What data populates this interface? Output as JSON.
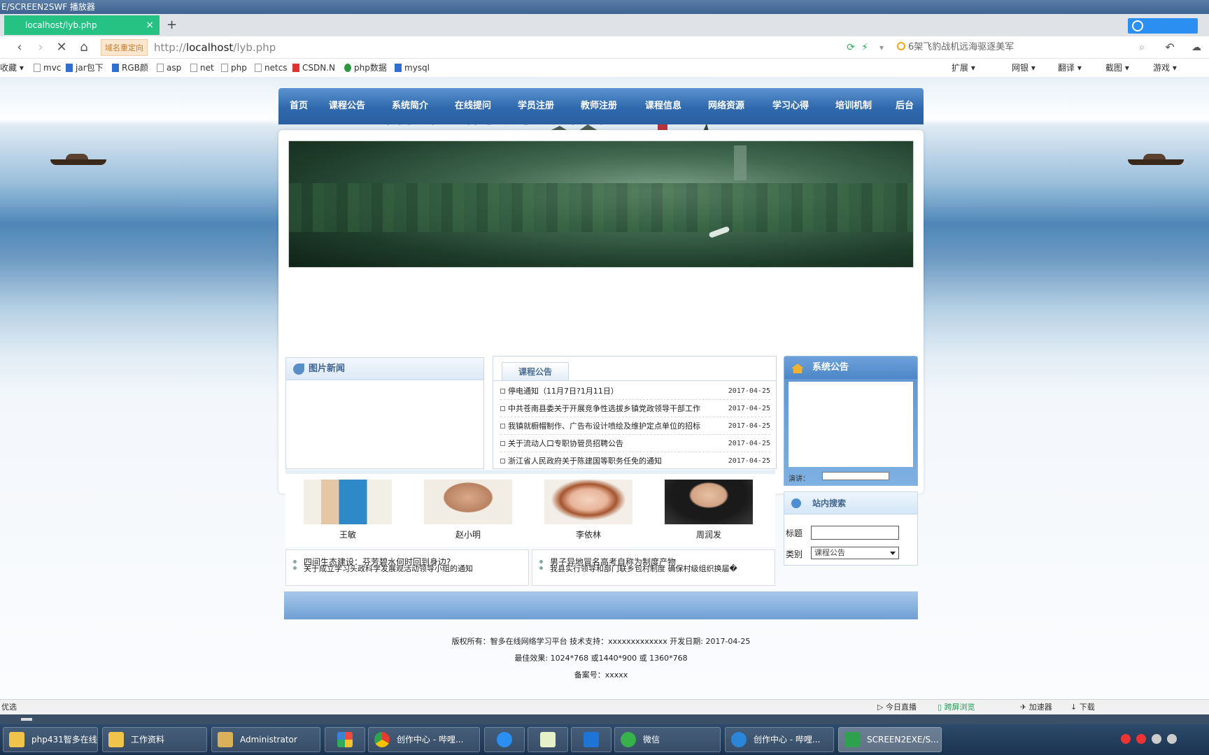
{
  "window": {
    "title": "E/SCREEN2SWF 播放器"
  },
  "browser": {
    "tab_title": "localhost/lyb.php",
    "tab_close": "×",
    "new_tab": "+",
    "cloud_button": "",
    "redirect_badge": "域名重定向",
    "url_prefix": "http://",
    "url_host": "localhost",
    "url_path": "/lyb.php",
    "search_hint": "6架飞豹战机远海驱逐美军",
    "bookmarks": [
      "收藏",
      "mvc",
      "jar包下",
      "RGB颜",
      "asp",
      "net",
      "php",
      "netcs",
      "CSDN.N",
      "php数据",
      "mysql"
    ],
    "toolbar_right": [
      "扩展",
      "网银",
      "翻译",
      "截图",
      "游戏"
    ]
  },
  "site": {
    "title": "智多在线网络学习平台",
    "menu": [
      "首页",
      "课程公告",
      "系统简介",
      "在线提问",
      "学员注册",
      "教师注册",
      "课程信息",
      "网络资源",
      "学习心得",
      "培训机制",
      "后台"
    ],
    "pic_news_title": "图片新闻",
    "course_notice_title": "课程公告",
    "notices": [
      {
        "title": "停电通知（11月7日?1月11日）",
        "date": "2017-04-25"
      },
      {
        "title": "中共苍南县委关于开展竞争性选拔乡镇党政领导干部工作",
        "date": "2017-04-25"
      },
      {
        "title": "我镇就橱帽制作、广告布设计喷绘及维护定点单位的招标",
        "date": "2017-04-25"
      },
      {
        "title": "关于流动人口专职协管员招聘公告",
        "date": "2017-04-25"
      },
      {
        "title": "浙江省人民政府关于陈建国等职务任免的通知",
        "date": "2017-04-25"
      }
    ],
    "sys_notice_title": "系统公告",
    "sys_notice_cut_label": "演讲：",
    "search_title": "站内搜索",
    "search_label_title": "标题",
    "search_label_category": "类别",
    "search_category_value": "课程公告",
    "teachers": [
      "王敏",
      "赵小明",
      "李依林",
      "周润发"
    ],
    "list_left": [
      "四间生态建设：芬芳碧水何时回到身边?",
      "关于成立学习头政科学发展观活动领导小组的通知"
    ],
    "list_right": [
      "男子异地冒名高考自称为制度产物",
      "我县实行领导和部门联乡包村制度"
    ],
    "list_right_suffix": "确保村级组织换届�",
    "footer_lines": [
      "版权所有：智多在线网络学习平台 技术支持：xxxxxxxxxxxxx 开发日期: 2017-04-25",
      "最佳效果: 1024*768 或1440*900 或 1360*768",
      "备案号：xxxxx"
    ]
  },
  "statusbar": {
    "left": "优选",
    "items": [
      "今日直播",
      "跨屏浏览",
      "加速器",
      "下载"
    ]
  },
  "taskbar": {
    "tasks": [
      "php431智多在线...",
      "工作资料",
      "Administrator",
      "",
      "创作中心 - 哔哩...",
      "",
      "",
      "",
      "微信",
      "创作中心 - 哔哩...",
      "SCREEN2EXE/S..."
    ]
  },
  "colors": {
    "tab_active": "#25c283",
    "menu_bar": "#2f69ad",
    "panel_head_text": "#40658f",
    "taskbar": "#1b3350"
  },
  "icons": [
    "back-icon",
    "forward-icon",
    "stop-icon",
    "home-icon",
    "search-icon",
    "undo-icon",
    "cloud-icon"
  ]
}
